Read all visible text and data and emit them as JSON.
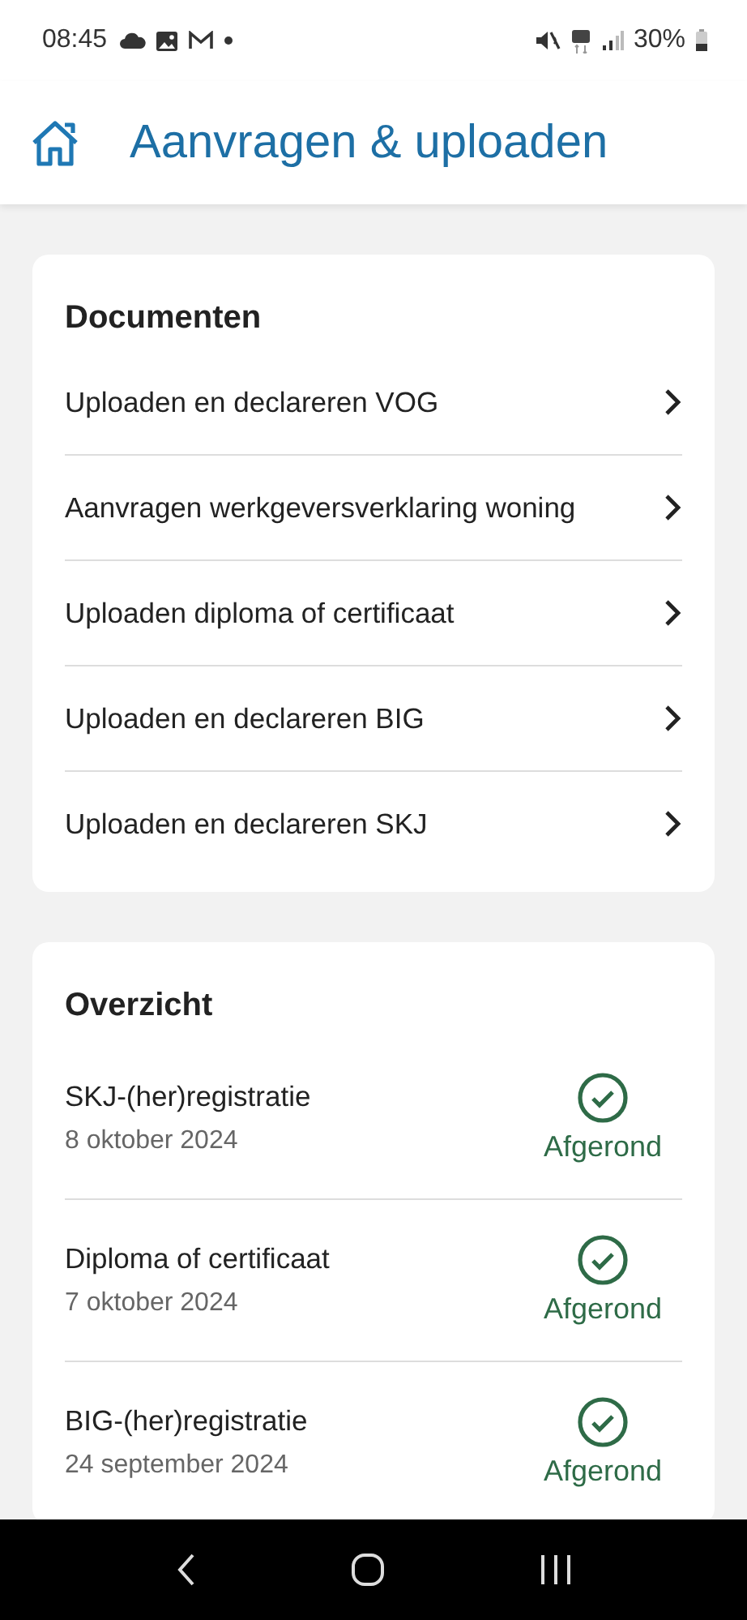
{
  "status_bar": {
    "time": "08:45",
    "battery": "30%"
  },
  "header": {
    "title": "Aanvragen & uploaden"
  },
  "documents": {
    "title": "Documenten",
    "items": [
      {
        "label": "Uploaden en declareren VOG"
      },
      {
        "label": "Aanvragen werkgeversverklaring woning"
      },
      {
        "label": "Uploaden diploma of certificaat"
      },
      {
        "label": "Uploaden en declareren BIG"
      },
      {
        "label": "Uploaden en declareren SKJ"
      }
    ]
  },
  "overview": {
    "title": "Overzicht",
    "items": [
      {
        "name": "SKJ-(her)registratie",
        "date": "8 oktober 2024",
        "kind": "completed",
        "status": "Afgerond"
      },
      {
        "name": "Diploma of certificaat",
        "date": "7 oktober 2024",
        "kind": "completed",
        "status": "Afgerond"
      },
      {
        "name": "BIG-(her)registratie",
        "date": "24 september 2024",
        "kind": "completed",
        "status": "Afgerond"
      }
    ]
  }
}
